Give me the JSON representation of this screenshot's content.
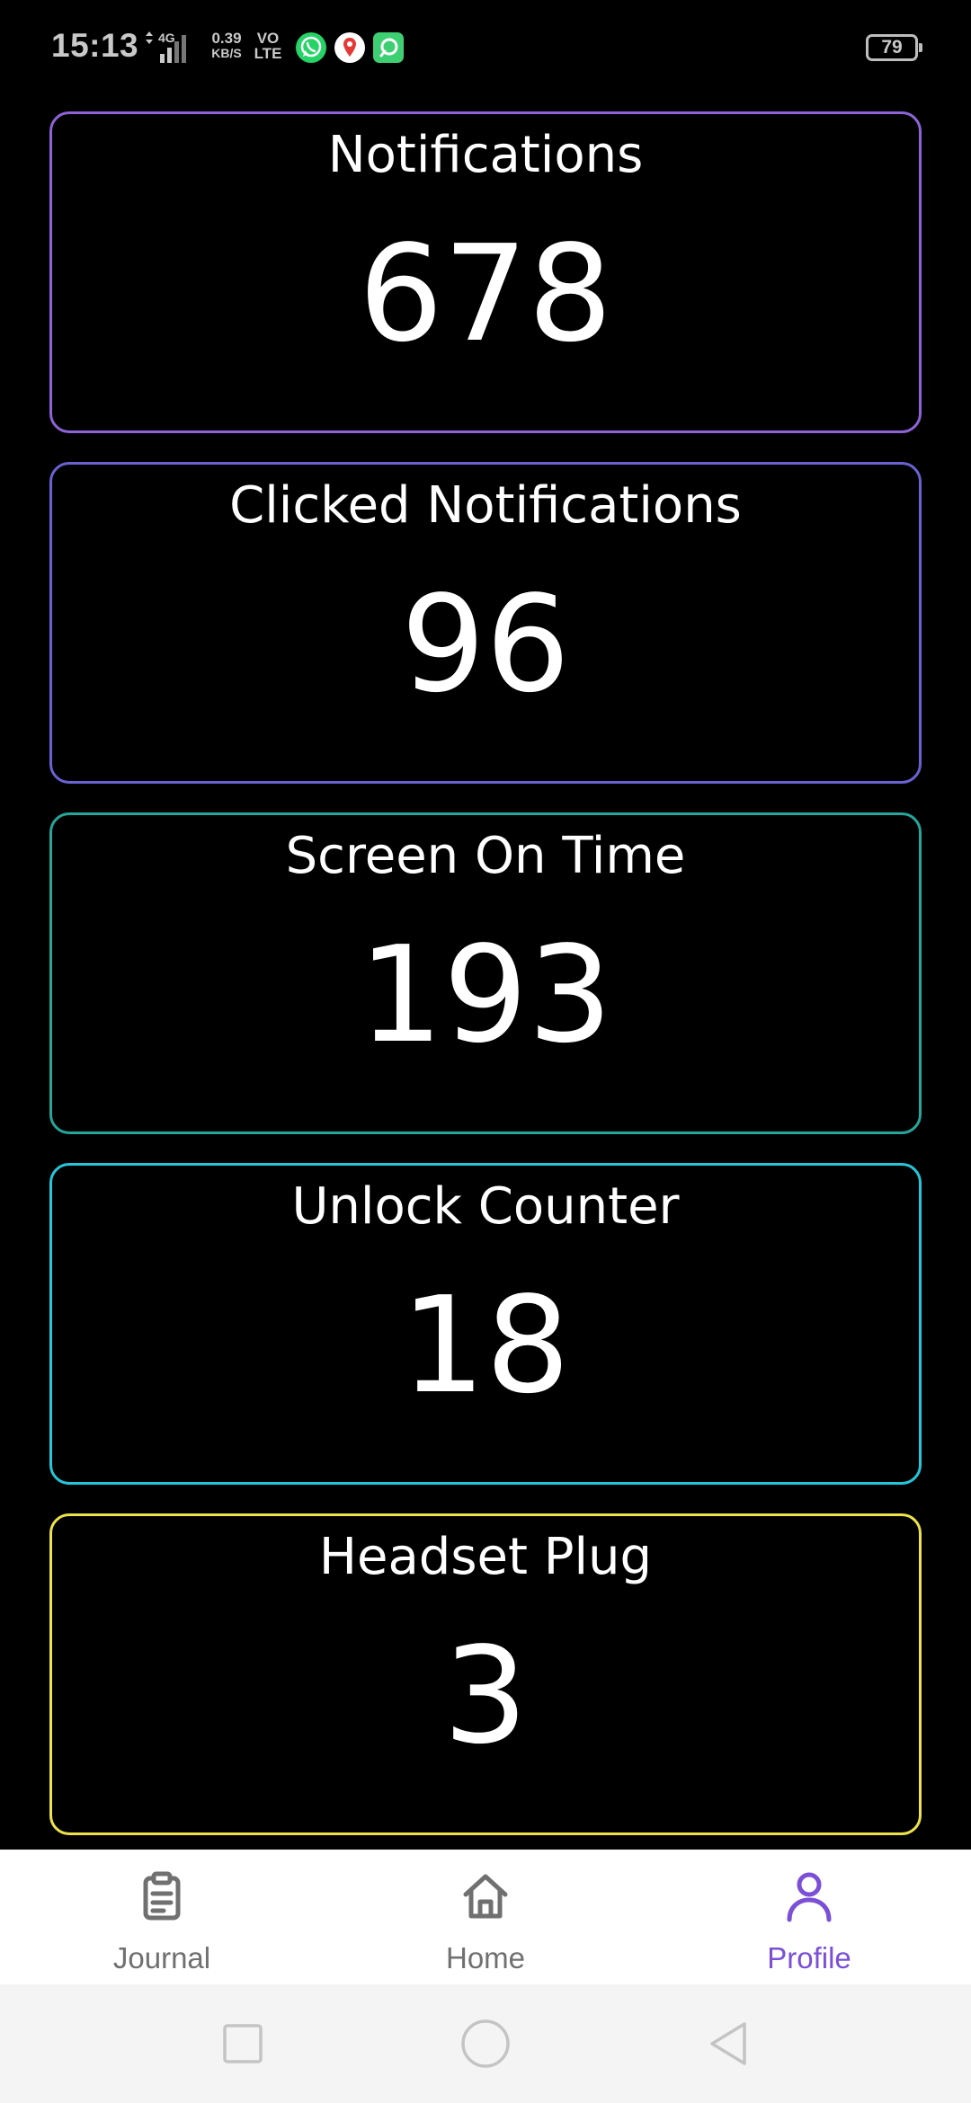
{
  "status_bar": {
    "time": "15:13",
    "network": "4G",
    "speed_value": "0.39",
    "speed_unit": "KB/S",
    "volte_top": "VO",
    "volte_bottom": "LTE",
    "battery": "79",
    "notification_icons": [
      "whatsapp-icon",
      "maps-pin-icon",
      "green-app-icon"
    ]
  },
  "cards": [
    {
      "title": "Notifications",
      "value": "678",
      "border_color": "#8e63d6"
    },
    {
      "title": "Clicked Notifications",
      "value": "96",
      "border_color": "#6b62d2"
    },
    {
      "title": "Screen On Time",
      "value": "193",
      "border_color": "#26a69a"
    },
    {
      "title": "Unlock Counter",
      "value": "18",
      "border_color": "#26c6da"
    },
    {
      "title": "Headset Plug",
      "value": "3",
      "border_color": "#ede24a"
    }
  ],
  "partial_card_border_color": "#e7e24a",
  "bottom_nav": {
    "items": [
      {
        "label": "Journal",
        "icon": "clipboard-icon"
      },
      {
        "label": "Home",
        "icon": "home-icon"
      },
      {
        "label": "Profile",
        "icon": "person-icon"
      }
    ],
    "active": "Profile",
    "active_color": "#7b4fd6",
    "inactive_color": "#707070"
  },
  "system_nav": {
    "buttons": [
      "recents-square-icon",
      "home-circle-icon",
      "back-triangle-icon"
    ]
  }
}
